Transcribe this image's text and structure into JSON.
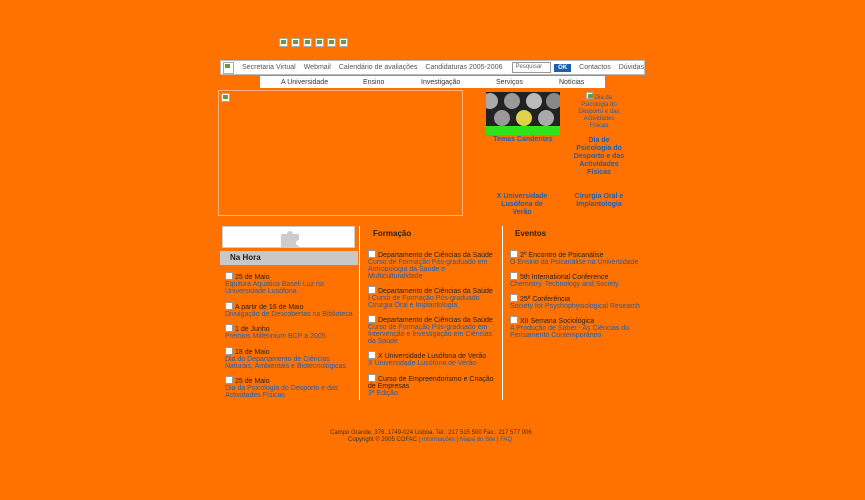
{
  "top_links": {
    "secretaria": "Secretaria Virtual",
    "webmail": "Webmail",
    "calendario": "Calendário de avaliações",
    "candidaturas": "Candidaturas 2005-2006",
    "search_placeholder": "Pesquisar",
    "ok": "OK",
    "contactos": "Contactos",
    "duvidas": "Dúvidas"
  },
  "nav": [
    "A Universidade",
    "Ensino",
    "Investigação",
    "Serviços",
    "Notícias"
  ],
  "temas": "Temas Candentes",
  "alt_jornadas": "Dia da Psicologia do Desporto e das Actividades Físicas",
  "dia_psicologia": "Dia de Psicologia do Desporto e das Actividades Físicas",
  "universidade_verao": "X Universidade Lusófona de Verão",
  "cirurgia": "Cirurgia Oral e Implantologia",
  "na_hora": {
    "title": "Na Hora",
    "items": [
      {
        "date": "25 de Maio",
        "text": "Equitura Aquática Baseli Luz na Universidade Lusófona"
      },
      {
        "date": "A partir de 16 de Maio",
        "text": "Divulgação de Descobertas na Biblioteca"
      },
      {
        "date": "1 de Junho",
        "text": "Prémios Millennium BCP a 2005"
      },
      {
        "date": "18 de Maio",
        "text": "Dia do Departamento de Ciências Naturais, Ambientais e Biotecnológicas"
      },
      {
        "date": "25 de Maio",
        "text": "Dia da Psicologia do Desporto e das Actividades Físicas"
      }
    ]
  },
  "formacao": {
    "title": "Formação",
    "items": [
      {
        "date": "Departamento de Ciências da Saúde",
        "text": "Curso de Formação Pós-graduado em Antropologia da Saúde e Multiculturalidade"
      },
      {
        "date": "Departamento de Ciências da Saúde",
        "text": "I Curso de Formação Pós-graduado Cirurgia Oral e Implantologia"
      },
      {
        "date": "Departamento de Ciências da Saúde",
        "text": "Curso de Formação Pós-graduado em Intervenção e Investigação em Ciências da Saúde"
      },
      {
        "date": "X Universidade Lusófona de Verão",
        "text": "X Universidade Lusófona de Verão"
      },
      {
        "date": "Curso de Empreendorismo e Criação de Empresas",
        "text": "3ª Edição"
      }
    ]
  },
  "eventos": {
    "title": "Eventos",
    "items": [
      {
        "date": "2º Encontro de Psicanálise",
        "text": "O Ensino da Psicanálise na Universidade"
      },
      {
        "date": "5th International Conference",
        "text": "Chemistry, Technology and Society"
      },
      {
        "date": "25ª Conferência",
        "text": "Society for Psychophysiological Research"
      },
      {
        "date": "XII Semana Sociológica",
        "text": "A Produção de Saber - As Ciências do Pensamento Contemporâneo"
      }
    ]
  },
  "footer": {
    "line1": "Campo Grande, 376, 1749-024 Lisboa. Tel.: 217 515 500 Fax.: 217 577 006",
    "line2": "Copyright © 2005 COFAC |",
    "links": [
      "Informações",
      "Mapa do Site",
      "FAQ"
    ]
  },
  "colors": {
    "background": "#ff7200",
    "link": "#1a5fb4",
    "accent_green": "#2fe21a"
  }
}
